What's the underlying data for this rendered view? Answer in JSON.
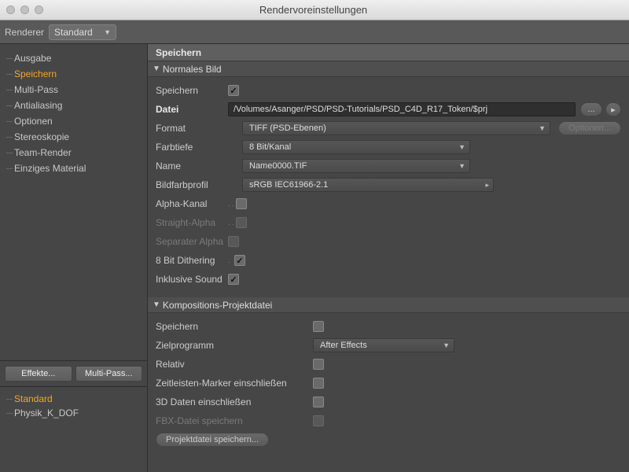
{
  "window": {
    "title": "Rendervoreinstellungen"
  },
  "toolbar": {
    "renderer_label": "Renderer",
    "renderer_value": "Standard"
  },
  "sidebar": {
    "items": [
      {
        "label": "Ausgabe"
      },
      {
        "label": "Speichern"
      },
      {
        "label": "Multi-Pass"
      },
      {
        "label": "Antialiasing"
      },
      {
        "label": "Optionen"
      },
      {
        "label": "Stereoskopie"
      },
      {
        "label": "Team-Render"
      },
      {
        "label": "Einziges Material"
      }
    ],
    "active_index": 1,
    "effects_btn": "Effekte...",
    "multipass_btn": "Multi-Pass...",
    "presets": [
      {
        "label": "Standard",
        "active": true
      },
      {
        "label": "Physik_K_DOF",
        "active": false
      }
    ]
  },
  "panel": {
    "title": "Speichern",
    "group1": {
      "title": "Normales Bild",
      "save_label": "Speichern",
      "save_checked": true,
      "file_label": "Datei",
      "file_value": "/Volumes/Asanger/PSD/PSD-Tutorials/PSD_C4D_R17_Token/$prj",
      "browse": "...",
      "format_label": "Format",
      "format_value": "TIFF (PSD-Ebenen)",
      "options_btn": "Optionen...",
      "depth_label": "Farbtiefe",
      "depth_value": "8 Bit/Kanal",
      "name_label": "Name",
      "name_value": "Name0000.TIF",
      "profile_label": "Bildfarbprofil",
      "profile_value": "sRGB IEC61966-2.1",
      "alpha_label": "Alpha-Kanal",
      "straight_label": "Straight-Alpha",
      "separate_label": "Separater Alpha",
      "dither_label": "8 Bit Dithering",
      "sound_label": "Inklusive Sound"
    },
    "group2": {
      "title": "Kompositions-Projektdatei",
      "save_label": "Speichern",
      "target_label": "Zielprogramm",
      "target_value": "After Effects",
      "relative_label": "Relativ",
      "marker_label": "Zeitleisten-Marker einschließen",
      "data3d_label": "3D Daten einschließen",
      "fbx_label": "FBX-Datei speichern",
      "save_proj_btn": "Projektdatei speichern..."
    }
  }
}
